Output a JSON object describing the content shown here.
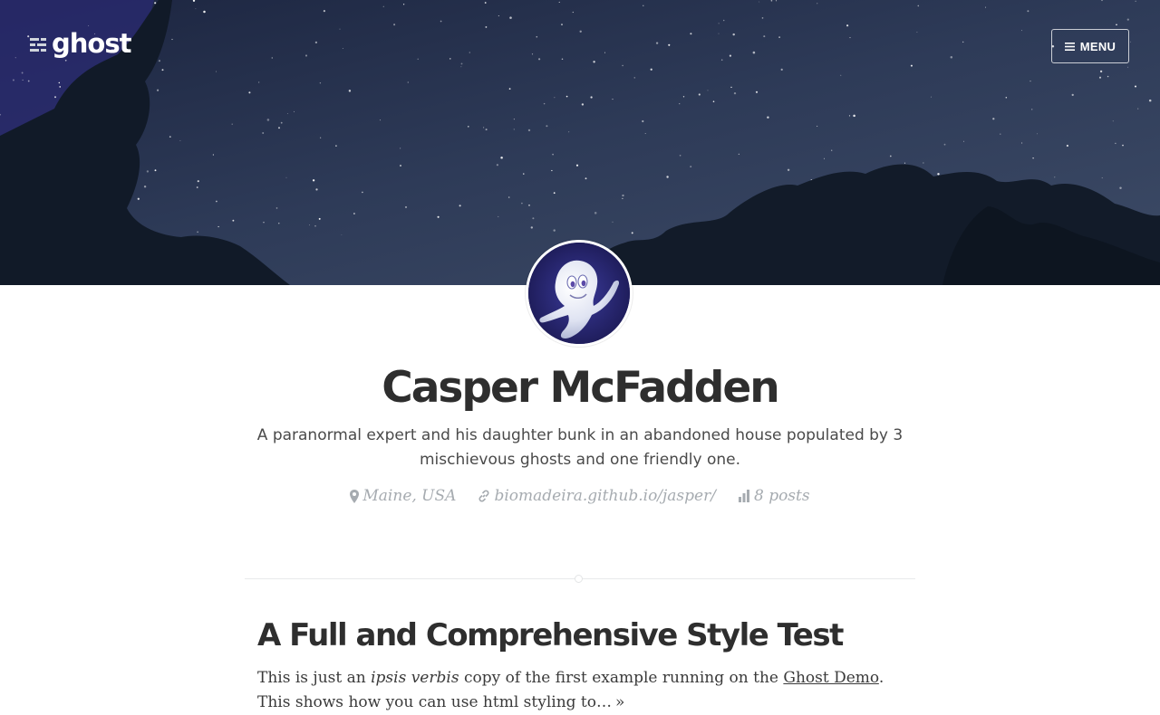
{
  "header": {
    "logo_text": "ghost",
    "menu_label": "MENU",
    "menu_icon": "hamburger-icon"
  },
  "author": {
    "name": "Casper McFadden",
    "bio": "A paranormal expert and his daughter bunk in an abandoned house populated by 3 mischievous ghosts and one friendly one.",
    "location": "Maine, USA",
    "website": "biomadeira.github.io/jasper/",
    "post_count": "8 posts",
    "avatar": "ghost-avatar"
  },
  "post": {
    "title": "A Full and Comprehensive Style Test",
    "excerpt_part1": "This is just an ",
    "excerpt_em": "ipsis verbis",
    "excerpt_part2": " copy of the first example running on the ",
    "excerpt_link": "Ghost Demo",
    "excerpt_part3": ". This shows how you can use html styling to…",
    "read_more": "»"
  },
  "colors": {
    "title": "#2e2e2e",
    "meta": "#a6abb0",
    "cover_sky": "#2b3753"
  }
}
